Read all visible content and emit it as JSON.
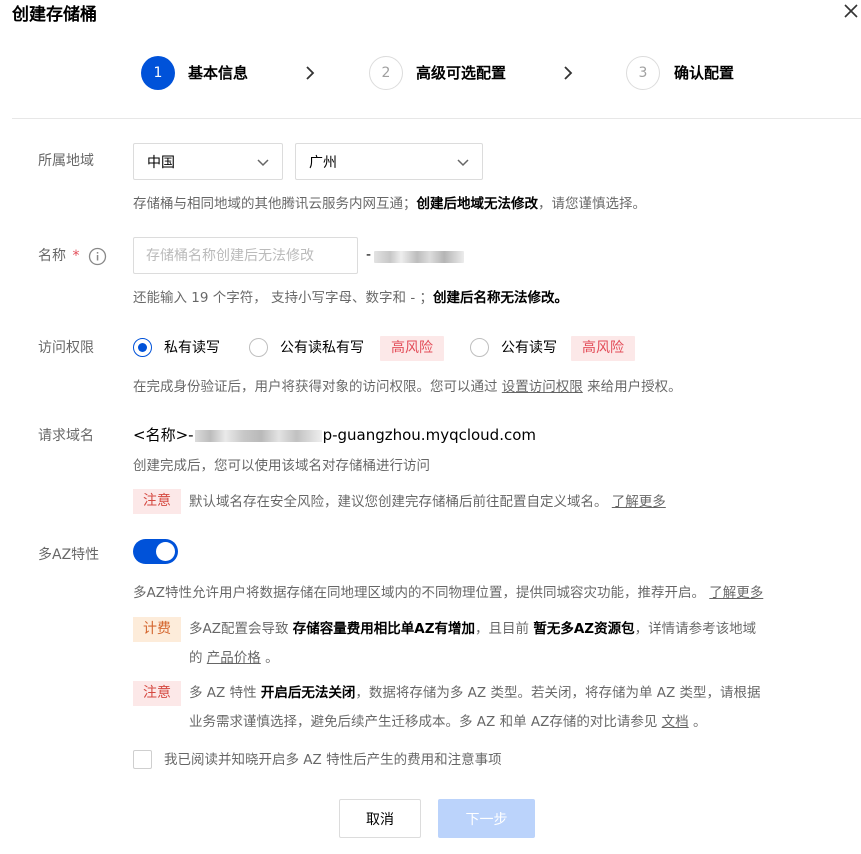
{
  "dialog": {
    "title": "创建存储桶"
  },
  "steps": [
    {
      "num": "1",
      "label": "基本信息"
    },
    {
      "num": "2",
      "label": "高级可选配置"
    },
    {
      "num": "3",
      "label": "确认配置"
    }
  ],
  "region": {
    "label": "所属地域",
    "country": "中国",
    "city": "广州",
    "help_prefix": "存储桶与相同地域的其他腾讯云服务内网互通；",
    "help_bold": "创建后地域无法修改",
    "help_suffix": "，请您谨慎选择。"
  },
  "name": {
    "label": "名称",
    "required_mark": "*",
    "placeholder": "存储桶名称创建后无法修改",
    "suffix_dash": "-",
    "help_prefix": "还能输入 19 个字符，  支持小写字母、数字和 - ；",
    "help_bold": "创建后名称无法修改。"
  },
  "access": {
    "label": "访问权限",
    "options": [
      {
        "label": "私有读写",
        "checked": true
      },
      {
        "label": "公有读私有写",
        "risk": "高风险"
      },
      {
        "label": "公有读写",
        "risk": "高风险"
      }
    ],
    "help_prefix": "在完成身份验证后，用户将获得对象的访问权限。您可以通过",
    "help_link": "设置访问权限",
    "help_suffix": "来给用户授权。"
  },
  "domain": {
    "label": "请求域名",
    "prefix": "<名称>-",
    "suffix": "p-guangzhou.myqcloud.com",
    "help": "创建完成后，您可以使用该域名对存储桶进行访问",
    "tag": "注意",
    "warn_text": "默认域名存在安全风险，建议您创建完存储桶后前往配置自定义域名。",
    "warn_link": "了解更多"
  },
  "multi_az": {
    "label": "多AZ特性",
    "enabled": true,
    "help": "多AZ特性允许用户将数据存储在同地理区域内的不同物理位置，提供同城容灾功能，推荐开启。",
    "help_link": "了解更多",
    "fee_tag": "计费",
    "fee_t1": "多AZ配置会导致",
    "fee_b1": "存储容量费用相比单AZ有增加",
    "fee_t2": "，且目前",
    "fee_b2": "暂无多AZ资源包",
    "fee_t3": "，详情请参考该地域",
    "fee_t4": "的",
    "fee_link": "产品价格",
    "fee_t5": "。",
    "note_tag": "注意",
    "note_t1": "多 AZ 特性",
    "note_b1": "开启后无法关闭",
    "note_t2": "，数据将存储为多 AZ 类型。若关闭，将存储为单 AZ 类型，请根据",
    "note_t3": "业务需求谨慎选择，避免后续产生迁移成本。多 AZ 和单 AZ存储的对比请参见",
    "note_link": "文档",
    "note_t4": "。",
    "ack_label": "我已阅读并知晓开启多 AZ 特性后产生的费用和注意事项"
  },
  "footer": {
    "cancel": "取消",
    "next": "下一步"
  },
  "colors": {
    "primary": "#0052d9",
    "risk_bg": "#fce8e8",
    "risk_text": "#e34d59",
    "fee_bg": "#fdecda",
    "fee_text": "#d4662f",
    "next_disabled": "#bbd3fb"
  }
}
